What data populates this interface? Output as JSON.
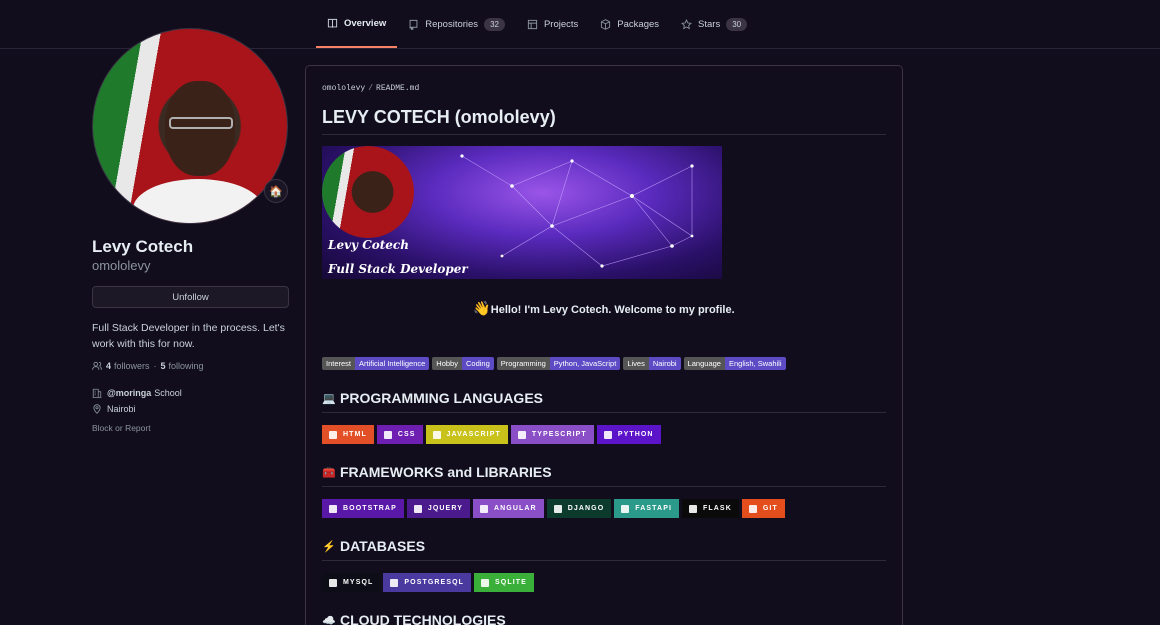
{
  "nav": {
    "tabs": [
      {
        "label": "Overview",
        "icon": "book-icon",
        "active": true
      },
      {
        "label": "Repositories",
        "icon": "repo-icon",
        "count": "32"
      },
      {
        "label": "Projects",
        "icon": "table-icon"
      },
      {
        "label": "Packages",
        "icon": "package-icon"
      },
      {
        "label": "Stars",
        "icon": "star-icon",
        "count": "30"
      }
    ]
  },
  "profile": {
    "fullname": "Levy Cotech",
    "login": "omololevy",
    "unfollow_label": "Unfollow",
    "bio": "Full Stack Developer in the process. Let's work with this for now.",
    "followers_count": "4",
    "followers_label": "followers",
    "following_count": "5",
    "following_label": "following",
    "separator": "·",
    "org": "@moringa",
    "org_suffix": "School",
    "location": "Nairobi",
    "report_label": "Block or Report",
    "status_emoji": "🏠"
  },
  "readme": {
    "owner": "omololevy",
    "file": "README.md",
    "title": "LEVY COTECH (omololevy)",
    "banner_line1": "Levy Cotech",
    "banner_line2": "Full Stack Developer",
    "hello": "Hello! I'm Levy Cotech. Welcome to my profile.",
    "wave": "👋",
    "pills": [
      {
        "key": "Interest",
        "value": "Artificial Intelligence"
      },
      {
        "key": "Hobby",
        "value": "Coding"
      },
      {
        "key": "Programming",
        "value": "Python, JavaScript"
      },
      {
        "key": "Lives",
        "value": "Nairobi"
      },
      {
        "key": "Language",
        "value": "English, Swahili"
      }
    ],
    "sections": [
      {
        "title": "PROGRAMMING LANGUAGES",
        "emoji": "💻",
        "badges": [
          {
            "label": "HTML",
            "color": "#e34f26"
          },
          {
            "label": "CSS",
            "color": "#6e1fb2"
          },
          {
            "label": "JAVASCRIPT",
            "color": "#c9c21a"
          },
          {
            "label": "TYPESCRIPT",
            "color": "#8a4fc6"
          },
          {
            "label": "PYTHON",
            "color": "#5b14c8"
          }
        ]
      },
      {
        "title": "FRAMEWORKS and LIBRARIES",
        "emoji": "🧰",
        "badges": [
          {
            "label": "BOOTSTRAP",
            "color": "#5a18a8"
          },
          {
            "label": "JQUERY",
            "color": "#4b1a8c"
          },
          {
            "label": "ANGULAR",
            "color": "#8a4fc6"
          },
          {
            "label": "DJANGO",
            "color": "#0c3b2e"
          },
          {
            "label": "FASTAPI",
            "color": "#2c9a8a"
          },
          {
            "label": "FLASK",
            "color": "#0a0a0a"
          },
          {
            "label": "GIT",
            "color": "#e44d1c"
          }
        ]
      },
      {
        "title": "DATABASES",
        "emoji": "⚡",
        "badges": [
          {
            "label": "MYSQL",
            "color": "#0d0d18"
          },
          {
            "label": "POSTGRESQL",
            "color": "#4a3aa0"
          },
          {
            "label": "SQLITE",
            "color": "#3ab03a"
          }
        ]
      },
      {
        "title": "CLOUD TECHNOLOGIES",
        "emoji": "☁️",
        "badges": []
      }
    ]
  }
}
